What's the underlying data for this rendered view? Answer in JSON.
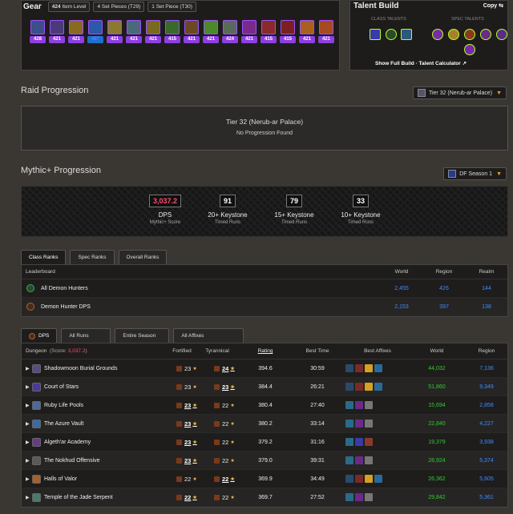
{
  "gear": {
    "title": "Gear",
    "item_level": "424",
    "item_level_label": "Item Level",
    "set_pieces_1": "4 Set Pieces (T29)",
    "set_pieces_2": "1 Set Piece (T30)",
    "items": [
      {
        "ilvl": "428",
        "color": "#3b4f8a"
      },
      {
        "ilvl": "421",
        "color": "#4b3a7a"
      },
      {
        "ilvl": "421",
        "color": "#8a6a20"
      },
      {
        "ilvl": "467",
        "color": "#2a5aa8",
        "blue": true
      },
      {
        "ilvl": "421",
        "color": "#8a7a30"
      },
      {
        "ilvl": "421",
        "color": "#4a6a7a"
      },
      {
        "ilvl": "421",
        "color": "#7a6a20"
      },
      {
        "ilvl": "415",
        "color": "#3a6a2a"
      },
      {
        "ilvl": "421",
        "color": "#6a4a20"
      },
      {
        "ilvl": "421",
        "color": "#4a8a2a"
      },
      {
        "ilvl": "424",
        "color": "#5a6a5a"
      },
      {
        "ilvl": "421",
        "color": "#7a2a8a"
      },
      {
        "ilvl": "415",
        "color": "#8a2a2a"
      },
      {
        "ilvl": "415",
        "color": "#7a2020"
      },
      {
        "ilvl": "421",
        "color": "#a86020"
      },
      {
        "ilvl": "421",
        "color": "#a84a20"
      }
    ]
  },
  "talent": {
    "title": "Talent Build",
    "copy": "Copy",
    "class_label": "CLASS TALENTS",
    "spec_label": "SPEC TALENTS",
    "full_build": "Show Full Build",
    "calculator": "Talent Calculator"
  },
  "raid": {
    "title": "Raid Progression",
    "dropdown": "Tier 32 (Nerub-ar Palace)",
    "box_title": "Tier 32 (Nerub-ar Palace)",
    "box_sub": "No Progression Found"
  },
  "mplus": {
    "title": "Mythic+ Progression",
    "dropdown": "DF Season 1",
    "stats": [
      {
        "value": "3,037.2",
        "l1": "DPS",
        "l2": "Mythic+ Score"
      },
      {
        "value": "91",
        "l1": "20+ Keystone",
        "l2": "Timed Runs"
      },
      {
        "value": "79",
        "l1": "15+ Keystone",
        "l2": "Timed Runs"
      },
      {
        "value": "33",
        "l1": "10+ Keystone",
        "l2": "Timed Runs"
      }
    ]
  },
  "ranks": {
    "tabs": [
      "Class Ranks",
      "Spec Ranks",
      "Overall Ranks"
    ],
    "headers": {
      "leaderboard": "Leaderboard",
      "world": "World",
      "region": "Region",
      "realm": "Realm"
    },
    "rows": [
      {
        "name": "All Demon Hunters",
        "world": "2,455",
        "region": "426",
        "realm": "144"
      },
      {
        "name": "Demon Hunter DPS",
        "world": "2,153",
        "region": "397",
        "realm": "138"
      }
    ]
  },
  "dungeons": {
    "tabs": [
      "DPS",
      "All Runs",
      "Entire Season",
      "All Affixes"
    ],
    "headers": {
      "dungeon": "Dungeon",
      "score_prefix": "(Score: ",
      "score": "3,037.2",
      "score_suffix": ")",
      "fortified": "Fortified",
      "tyrannical": "Tyrannical",
      "rating": "Rating",
      "best_time": "Best Time",
      "best_affixes": "Best Affixes",
      "world": "World",
      "region": "Region"
    },
    "rows": [
      {
        "name": "Shadowmoon Burial Grounds",
        "fort": "23",
        "tyr": "24",
        "tyr_bold": true,
        "fort_bold": false,
        "rating": "394.6",
        "time": "30:59",
        "world": "44,032",
        "region": "7,136",
        "icon": "#5a4a8a"
      },
      {
        "name": "Court of Stars",
        "fort": "23",
        "tyr": "23",
        "tyr_bold": true,
        "fort_bold": false,
        "rating": "384.4",
        "time": "26:21",
        "world": "51,860",
        "region": "9,349",
        "icon": "#4a3a9a"
      },
      {
        "name": "Ruby Life Pools",
        "fort": "23",
        "tyr": "22",
        "tyr_bold": false,
        "fort_bold": true,
        "rating": "380.4",
        "time": "27:40",
        "world": "15,694",
        "region": "2,858",
        "icon": "#4a6a9a"
      },
      {
        "name": "The Azure Vault",
        "fort": "23",
        "tyr": "22",
        "tyr_bold": false,
        "fort_bold": true,
        "rating": "380.2",
        "time": "33:14",
        "world": "22,840",
        "region": "4,227",
        "icon": "#3a6aa8"
      },
      {
        "name": "Algeth'ar Academy",
        "fort": "23",
        "tyr": "22",
        "tyr_bold": false,
        "fort_bold": true,
        "rating": "379.2",
        "time": "31:16",
        "world": "19,379",
        "region": "3,938",
        "icon": "#6a3a8a"
      },
      {
        "name": "The Nokhud Offensive",
        "fort": "23",
        "tyr": "22",
        "tyr_bold": false,
        "fort_bold": true,
        "rating": "379.0",
        "time": "39:31",
        "world": "28,924",
        "region": "5,374",
        "icon": "#5a5a5a"
      },
      {
        "name": "Halls of Valor",
        "fort": "22",
        "tyr": "22",
        "tyr_bold": true,
        "fort_bold": false,
        "rating": "369.9",
        "time": "34:49",
        "world": "26,362",
        "region": "5,605",
        "icon": "#a8602a"
      },
      {
        "name": "Temple of the Jade Serpent",
        "fort": "22",
        "tyr": "22",
        "tyr_bold": false,
        "fort_bold": true,
        "rating": "369.7",
        "time": "27:52",
        "world": "29,842",
        "region": "5,361",
        "icon": "#4a7a6a"
      }
    ]
  }
}
